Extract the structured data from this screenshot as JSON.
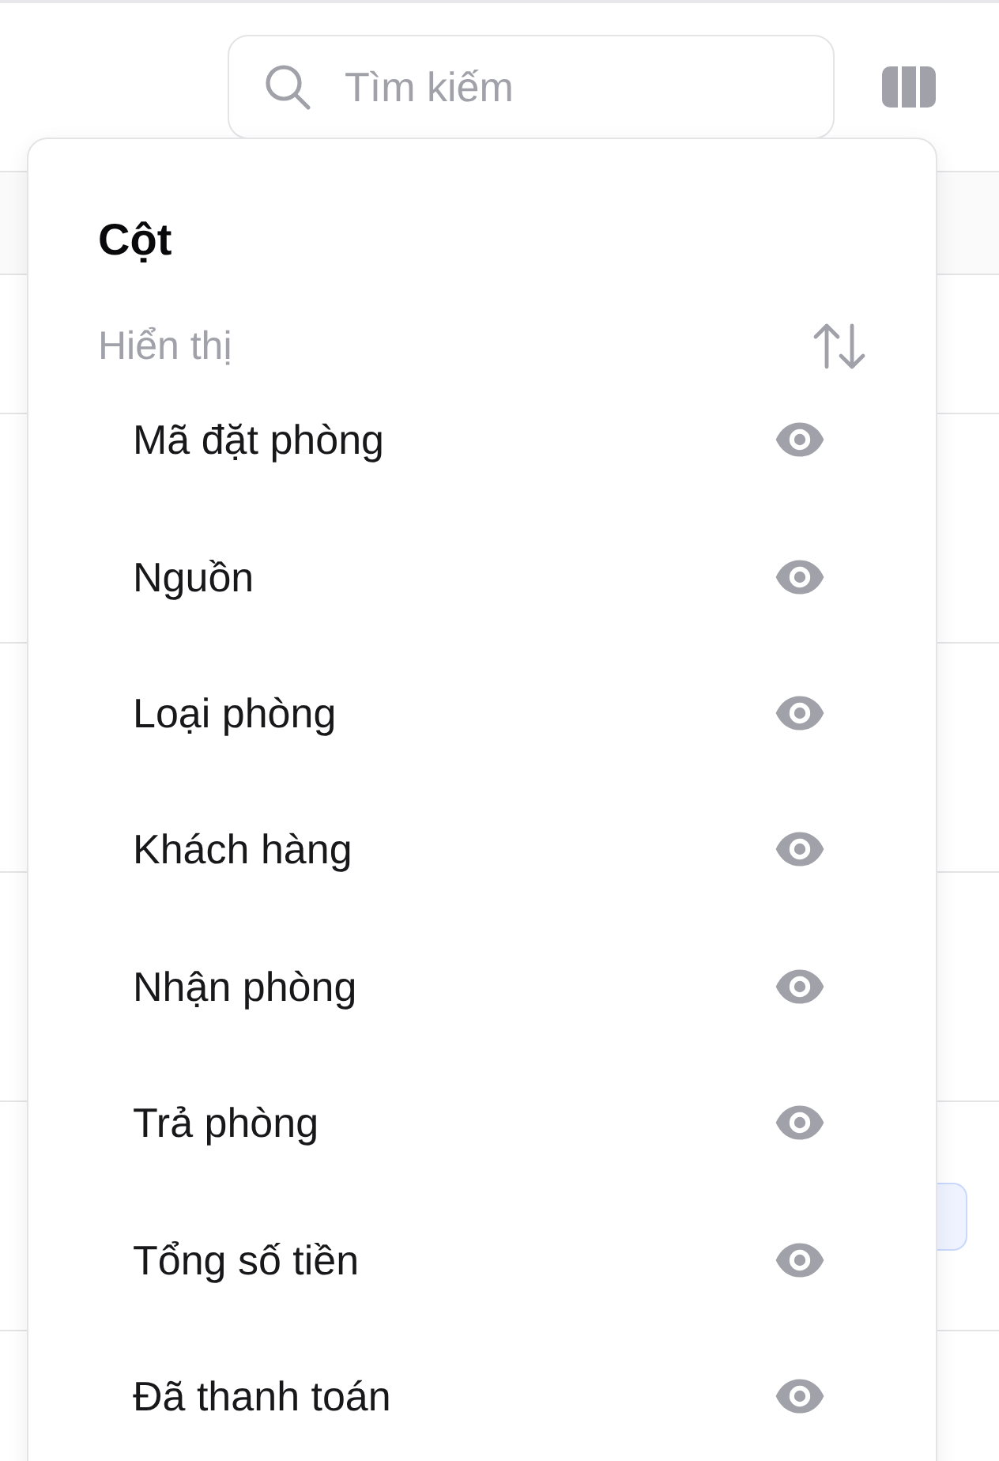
{
  "toolbar": {
    "search": {
      "placeholder": "Tìm kiếm"
    }
  },
  "table": {
    "rows": [
      {
        "badge": false
      },
      {
        "badge": false
      },
      {
        "badge": false
      },
      {
        "badge": false
      },
      {
        "badge": true
      },
      {
        "badge": false
      }
    ]
  },
  "columns_popover": {
    "title": "Cột",
    "section_label": "Hiển thị",
    "columns": [
      {
        "label": "Mã đặt phòng",
        "visible": true
      },
      {
        "label": "Nguồn",
        "visible": true
      },
      {
        "label": "Loại phòng",
        "visible": true
      },
      {
        "label": "Khách hàng",
        "visible": true
      },
      {
        "label": "Nhận phòng",
        "visible": true
      },
      {
        "label": "Trả phòng",
        "visible": true
      },
      {
        "label": "Tổng số tiền",
        "visible": true
      },
      {
        "label": "Đã thanh toán",
        "visible": true
      }
    ]
  }
}
